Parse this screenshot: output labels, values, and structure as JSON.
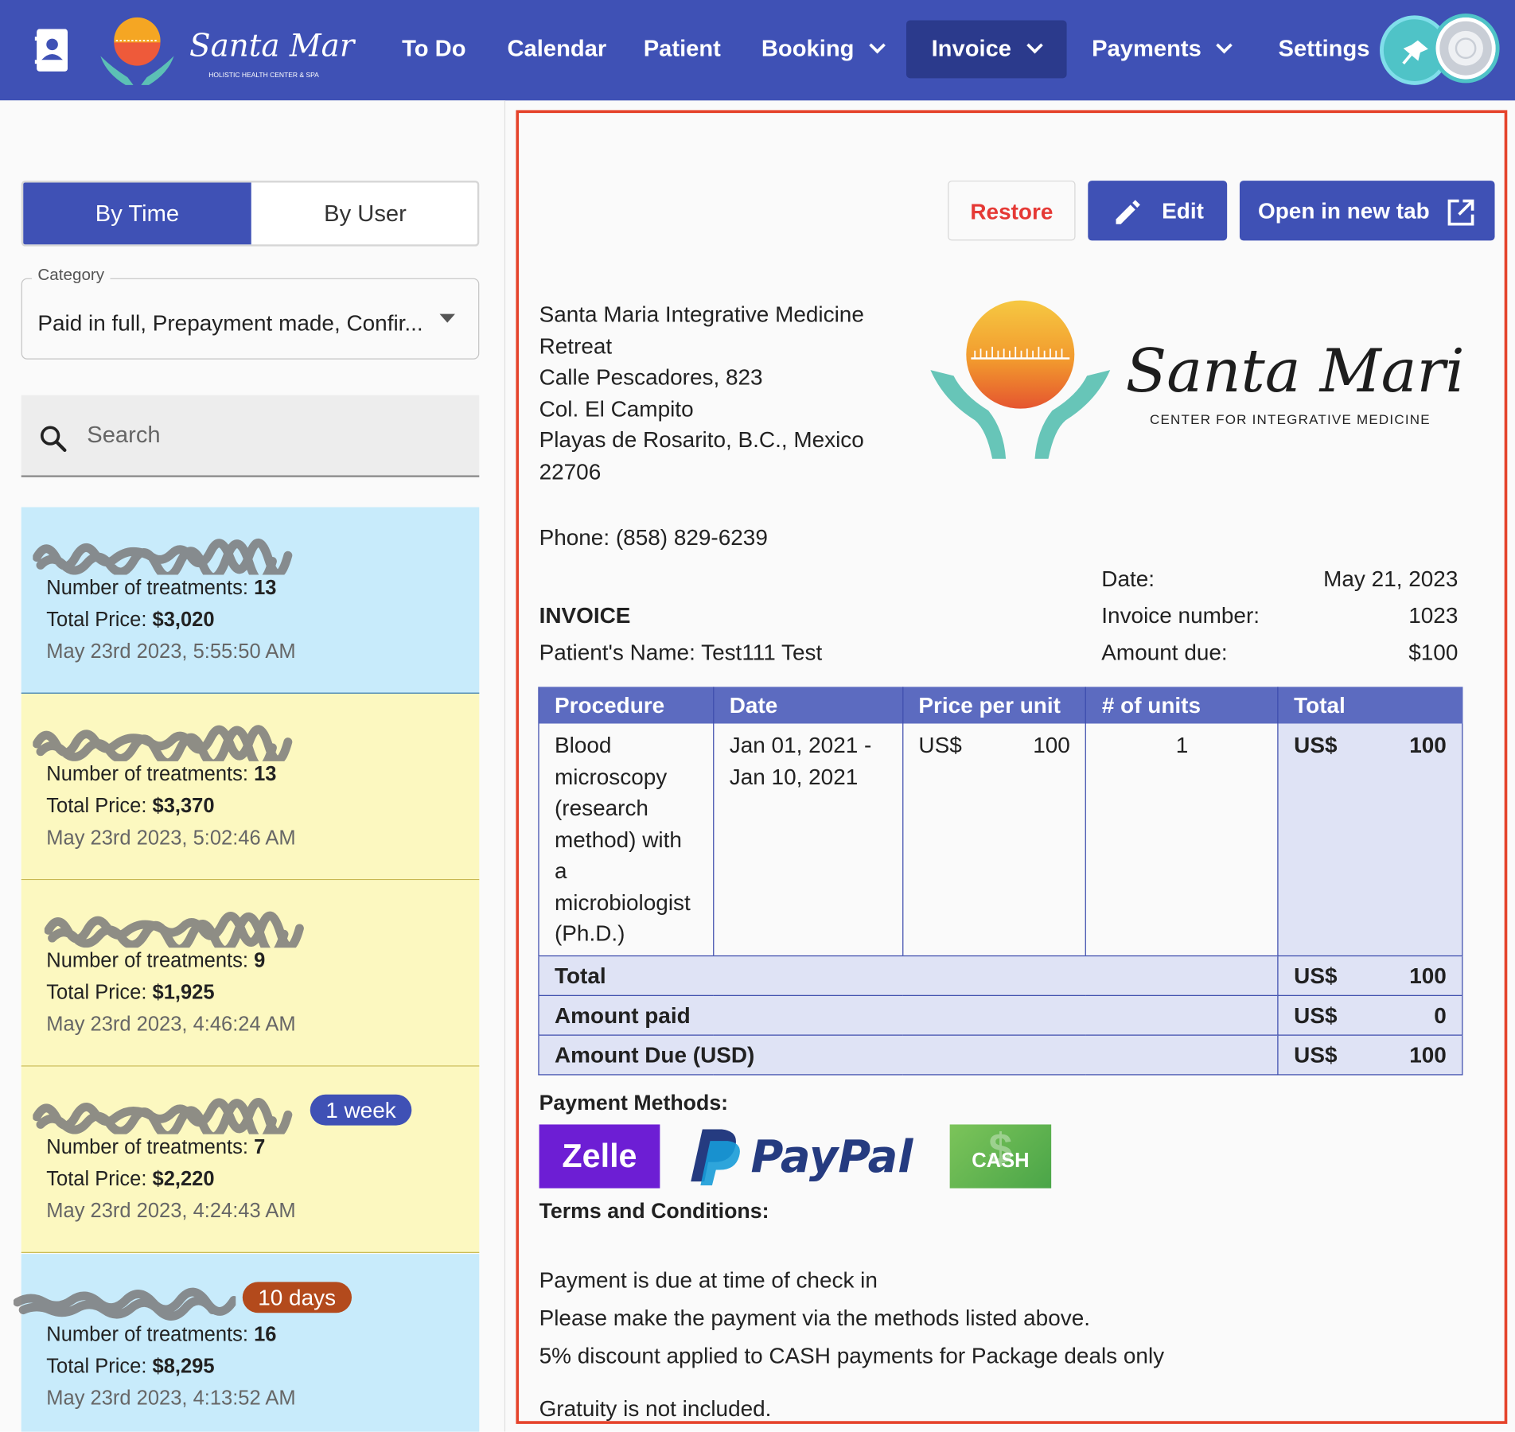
{
  "nav": {
    "brand_name": "Santa Maria",
    "brand_sub": "HOLISTIC HEALTH CENTER & SPA",
    "items": [
      {
        "label": "To Do"
      },
      {
        "label": "Calendar"
      },
      {
        "label": "Patient"
      },
      {
        "label": "Booking"
      },
      {
        "label": "Invoice"
      },
      {
        "label": "Payments"
      },
      {
        "label": "Settings"
      }
    ],
    "active": "Invoice",
    "colors": {
      "bar": "#3f51b5",
      "active": "#2b3a8c"
    }
  },
  "sidebar": {
    "toggle": {
      "by_time": "By Time",
      "by_user": "By User",
      "selected": "By Time"
    },
    "category": {
      "label": "Category",
      "value": "Paid in full, Prepayment made, Confir..."
    },
    "search": {
      "placeholder": "Search"
    },
    "treatments_label": "Number of treatments:",
    "price_label": "Total Price:",
    "cards": [
      {
        "color": "blue",
        "treatments": "13",
        "price": "$3,020",
        "date": "May 23rd 2023, 5:55:50 AM",
        "badge": ""
      },
      {
        "color": "yellow",
        "treatments": "13",
        "price": "$3,370",
        "date": "May 23rd 2023, 5:02:46 AM",
        "badge": ""
      },
      {
        "color": "yellow",
        "treatments": "9",
        "price": "$1,925",
        "date": "May 23rd 2023, 4:46:24 AM",
        "badge": ""
      },
      {
        "color": "yellow",
        "treatments": "7",
        "price": "$2,220",
        "date": "May 23rd 2023, 4:24:43 AM",
        "badge": "1 week"
      },
      {
        "color": "blue",
        "treatments": "16",
        "price": "$8,295",
        "date": "May 23rd 2023, 4:13:52 AM",
        "badge": "10 days"
      }
    ]
  },
  "invoice": {
    "buttons": {
      "restore": "Restore",
      "edit": "Edit",
      "open": "Open in new tab"
    },
    "address": [
      "Santa Maria Integrative Medicine",
      "Retreat",
      "Calle Pescadores, 823",
      "Col. El Campito",
      "Playas de Rosarito, B.C., Mexico",
      "22706"
    ],
    "logo_name": "Santa Maria",
    "logo_sub": "CENTER FOR INTEGRATIVE MEDICINE",
    "phone": "Phone: (858) 829-6239",
    "title": "INVOICE",
    "patient": "Patient's Name: Test111 Test",
    "meta": {
      "date_label": "Date:",
      "date_value": "May 21, 2023",
      "number_label": "Invoice number:",
      "number_value": "1023",
      "due_label": "Amount due:",
      "due_value": "$100"
    },
    "table": {
      "headers": [
        "Procedure",
        "Date",
        "Price per unit",
        "# of units",
        "Total"
      ],
      "row": {
        "procedure": "Blood microscopy (research method) with a microbiologist (Ph.D.)",
        "date_start": "Jan 01, 2021 -",
        "date_end": "Jan 10, 2021",
        "currency": "US$",
        "price": "100",
        "units": "1",
        "total": "100"
      },
      "summary": [
        {
          "label": "Total",
          "currency": "US$",
          "value": "100"
        },
        {
          "label": "Amount paid",
          "currency": "US$",
          "value": "0"
        },
        {
          "label": "Amount Due (USD)",
          "currency": "US$",
          "value": "100"
        }
      ]
    },
    "payment_title": "Payment Methods:",
    "payment_methods": [
      "Zelle",
      "PayPal",
      "CASH"
    ],
    "terms_title": "Terms and Conditions:",
    "terms": [
      "Payment is due at time of check in",
      "Please make the payment via the methods listed above.",
      "5% discount applied to CASH payments for Package deals only",
      "Gratuity is not included."
    ],
    "colors": {
      "header": "#5c6bc0",
      "total_cell": "#dfe3f5",
      "outline": "#e5442c",
      "restore": "#e53935"
    }
  }
}
